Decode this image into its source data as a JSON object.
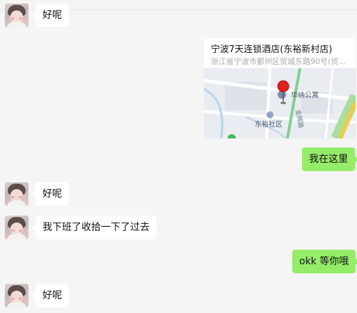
{
  "messages": [
    {
      "side": "left",
      "text": "好呢"
    },
    {
      "side": "right",
      "type": "location",
      "title": "宁波7天连锁酒店(东裕新村店)",
      "address": "浙江省宁波市鄞州区贸城东路90号(贸...",
      "map_labels": {
        "poi": "华纳公寓",
        "community": "东裕社区",
        "road": "金辉路"
      }
    },
    {
      "side": "right",
      "text": "我在这里"
    },
    {
      "side": "left",
      "text": "好呢"
    },
    {
      "side": "left",
      "text": "我下班了收拾一下了过去"
    },
    {
      "side": "right",
      "text": "okk 等你哦"
    },
    {
      "side": "left",
      "text": "好呢"
    }
  ],
  "colors": {
    "background": "#f5f5f5",
    "incoming_bubble": "#ffffff",
    "outgoing_bubble": "#95ec69",
    "map_pin": "#e02020"
  }
}
